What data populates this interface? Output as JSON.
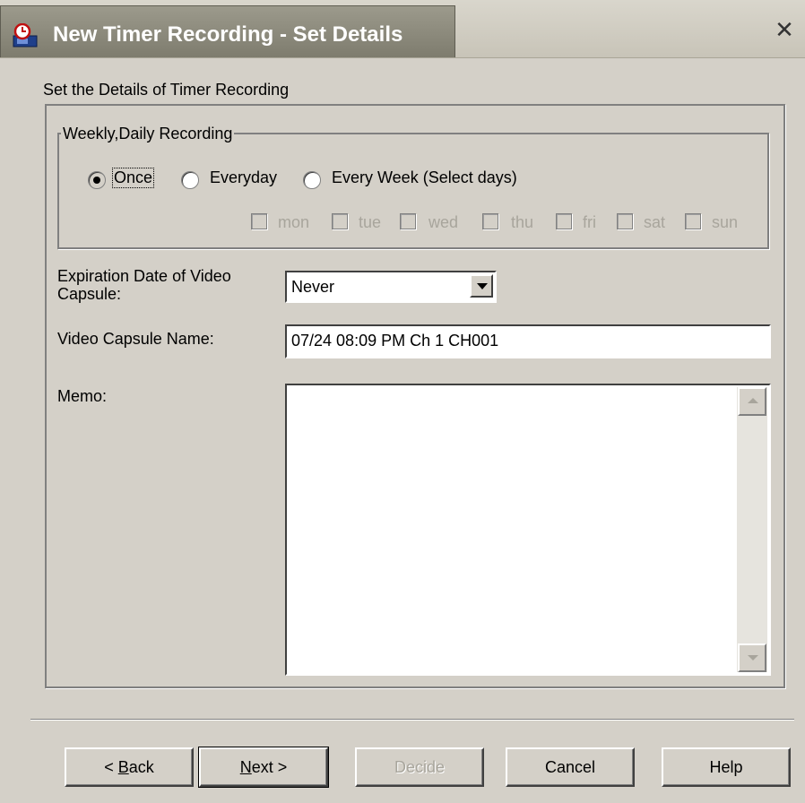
{
  "window": {
    "title": "New Timer Recording - Set Details",
    "icon": "recording-app-icon",
    "close_glyph": "✕"
  },
  "details": {
    "heading": "Set the Details of Timer Recording",
    "recording_group": {
      "legend": "Weekly,Daily Recording",
      "options": [
        {
          "label": "Once",
          "selected": true
        },
        {
          "label": "Everyday",
          "selected": false
        },
        {
          "label": "Every Week (Select days)",
          "selected": false
        }
      ],
      "days": [
        "mon",
        "tue",
        "wed",
        "thu",
        "fri",
        "sat",
        "sun"
      ]
    },
    "expiration": {
      "label_line1": "Expiration Date of Video",
      "label_line2": "Capsule:",
      "value": "Never"
    },
    "capsule_name": {
      "label": "Video Capsule Name:",
      "value": "07/24 08:09 PM Ch 1 CH001"
    },
    "memo": {
      "label": "Memo:",
      "value": ""
    }
  },
  "buttons": {
    "back_prefix": "< ",
    "back_key": "B",
    "back_rest": "ack",
    "next_key": "N",
    "next_rest": "ext >",
    "decide": "Decide",
    "cancel": "Cancel",
    "help": "Help"
  },
  "colors": {
    "dialog_bg": "#d4d0c8",
    "title_tab": "#8c8a7c",
    "disabled_text": "#a8a59c"
  }
}
